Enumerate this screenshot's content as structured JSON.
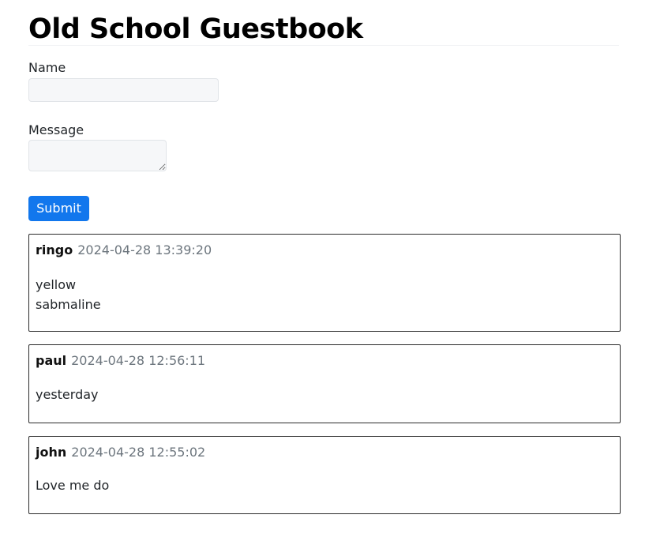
{
  "page": {
    "title": "Old School Guestbook"
  },
  "form": {
    "name_label": "Name",
    "name_value": "",
    "message_label": "Message",
    "message_value": "",
    "submit_label": "Submit"
  },
  "entries": [
    {
      "author": "ringo",
      "timestamp": "2024-04-28 13:39:20",
      "message": "yellow\nsabmaline"
    },
    {
      "author": "paul",
      "timestamp": "2024-04-28 12:56:11",
      "message": "yesterday"
    },
    {
      "author": "john",
      "timestamp": "2024-04-28 12:55:02",
      "message": "Love me do"
    }
  ],
  "colors": {
    "submit_background": "#1277ed",
    "timestamp_text": "#6c757d",
    "input_background": "#f6f7f9",
    "entry_border": "#2b2b2b"
  }
}
